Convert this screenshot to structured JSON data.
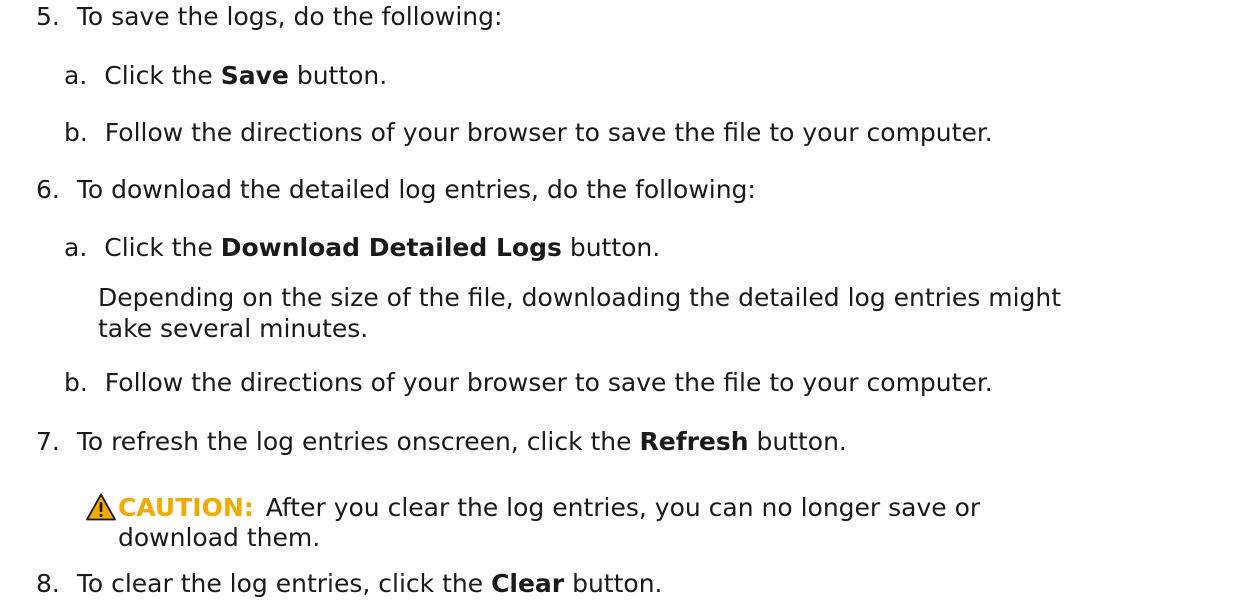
{
  "steps": [
    {
      "number": "5.",
      "text": "To save the logs, do the following:",
      "substeps": [
        {
          "letter": "a.",
          "before": "Click the ",
          "bold": "Save",
          "after": " button."
        },
        {
          "letter": "b.",
          "text": "Follow the directions of your browser to save the file to your computer."
        }
      ]
    },
    {
      "number": "6.",
      "text": "To download the detailed log entries, do the following:",
      "substeps": [
        {
          "letter": "a.",
          "before": "Click the ",
          "bold": "Download Detailed Logs",
          "after": " button.",
          "note_line1": "Depending on the size of the file, downloading the detailed log entries might",
          "note_line2": "take several minutes."
        },
        {
          "letter": "b.",
          "text": "Follow the directions of your browser to save the file to your computer."
        }
      ]
    },
    {
      "number": "7.",
      "before": "To refresh the log entries onscreen, click the ",
      "bold": "Refresh",
      "after": " button."
    },
    {
      "number": "8.",
      "before": "To clear the log entries, click the ",
      "bold": "Clear",
      "after": " button."
    }
  ],
  "caution": {
    "icon": "warning-triangle-icon",
    "label": "CAUTION:",
    "line1": " After you clear the log entries, you can no longer save or",
    "line2": "download them.",
    "color": "#f2a900"
  }
}
